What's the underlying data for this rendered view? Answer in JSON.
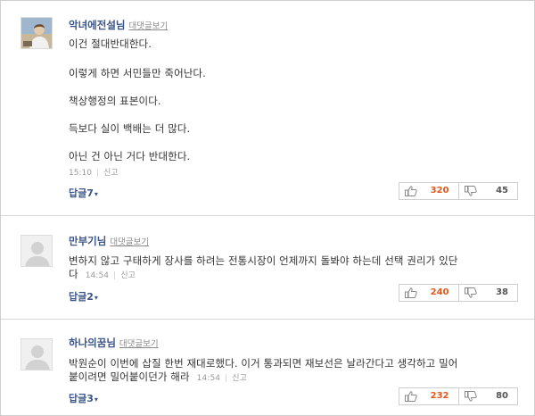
{
  "reply_view_label": "대댓글보기",
  "report_label": "신고",
  "colors": {
    "nickname": "#3a5588",
    "like_count": "#e05a1c",
    "dislike_count": "#555555"
  },
  "comments": [
    {
      "nickname": "악녀에전설님",
      "avatar": "user-photo",
      "lines": [
        "이건 절대반대한다.",
        "이렇게 하면 서민들만 죽어난다.",
        "책상행정의 표본이다.",
        "득보다 실이 백배는 더 많다.",
        "아닌 건 아닌 거다 반대한다."
      ],
      "time": "15:10",
      "replies_label": "답글7",
      "likes": "320",
      "dislikes": "45"
    },
    {
      "nickname": "만부기님",
      "avatar": "default-user",
      "lines": [
        "변하지 않고 구태하게 장사를 하려는 전통시장이 언제까지 돌봐야 하는데 선택 권리가 있단",
        "다"
      ],
      "time": "14:54",
      "replies_label": "답글2",
      "likes": "240",
      "dislikes": "38"
    },
    {
      "nickname": "하나의꿈님",
      "avatar": "default-user",
      "lines": [
        "박원순이 이번에 삽질 한번 재대로했다. 이거 통과되면 재보선은 날라간다고 생각하고 밀어",
        "붙이려면 밀어붙이던가 해라"
      ],
      "time": "14:54",
      "replies_label": "답글3",
      "likes": "232",
      "dislikes": "80"
    }
  ]
}
